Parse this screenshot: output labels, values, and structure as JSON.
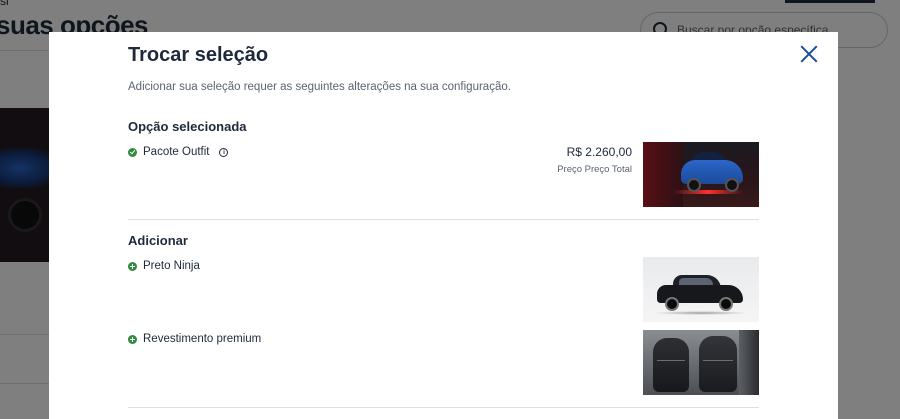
{
  "background": {
    "top_text": "si",
    "title": "suas opções",
    "search_placeholder": "Buscar por opção específica"
  },
  "modal": {
    "title": "Trocar seleção",
    "subtitle": "Adicionar sua seleção requer as seguintes alterações na sua configuração.",
    "selected_section": {
      "heading": "Opção selecionada",
      "item": {
        "label": "Pacote Outfit",
        "icon": "check-circle-icon",
        "info_icon": "info-icon",
        "price": "R$ 2.260,00",
        "price_label": "Preço Preço Total",
        "image": "blue-suv-thumbnail"
      }
    },
    "add_section": {
      "heading": "Adicionar",
      "items": [
        {
          "label": "Preto Ninja",
          "icon": "plus-circle-icon",
          "image": "black-suv-thumbnail"
        },
        {
          "label": "Revestimento premium",
          "icon": "plus-circle-icon",
          "image": "leather-seats-thumbnail"
        }
      ]
    }
  },
  "colors": {
    "accent_green": "#2f8a3f",
    "close_blue": "#1d4e96",
    "text_dark": "#1e2a3a",
    "overlay": "rgba(0,0,0,0.5)"
  }
}
